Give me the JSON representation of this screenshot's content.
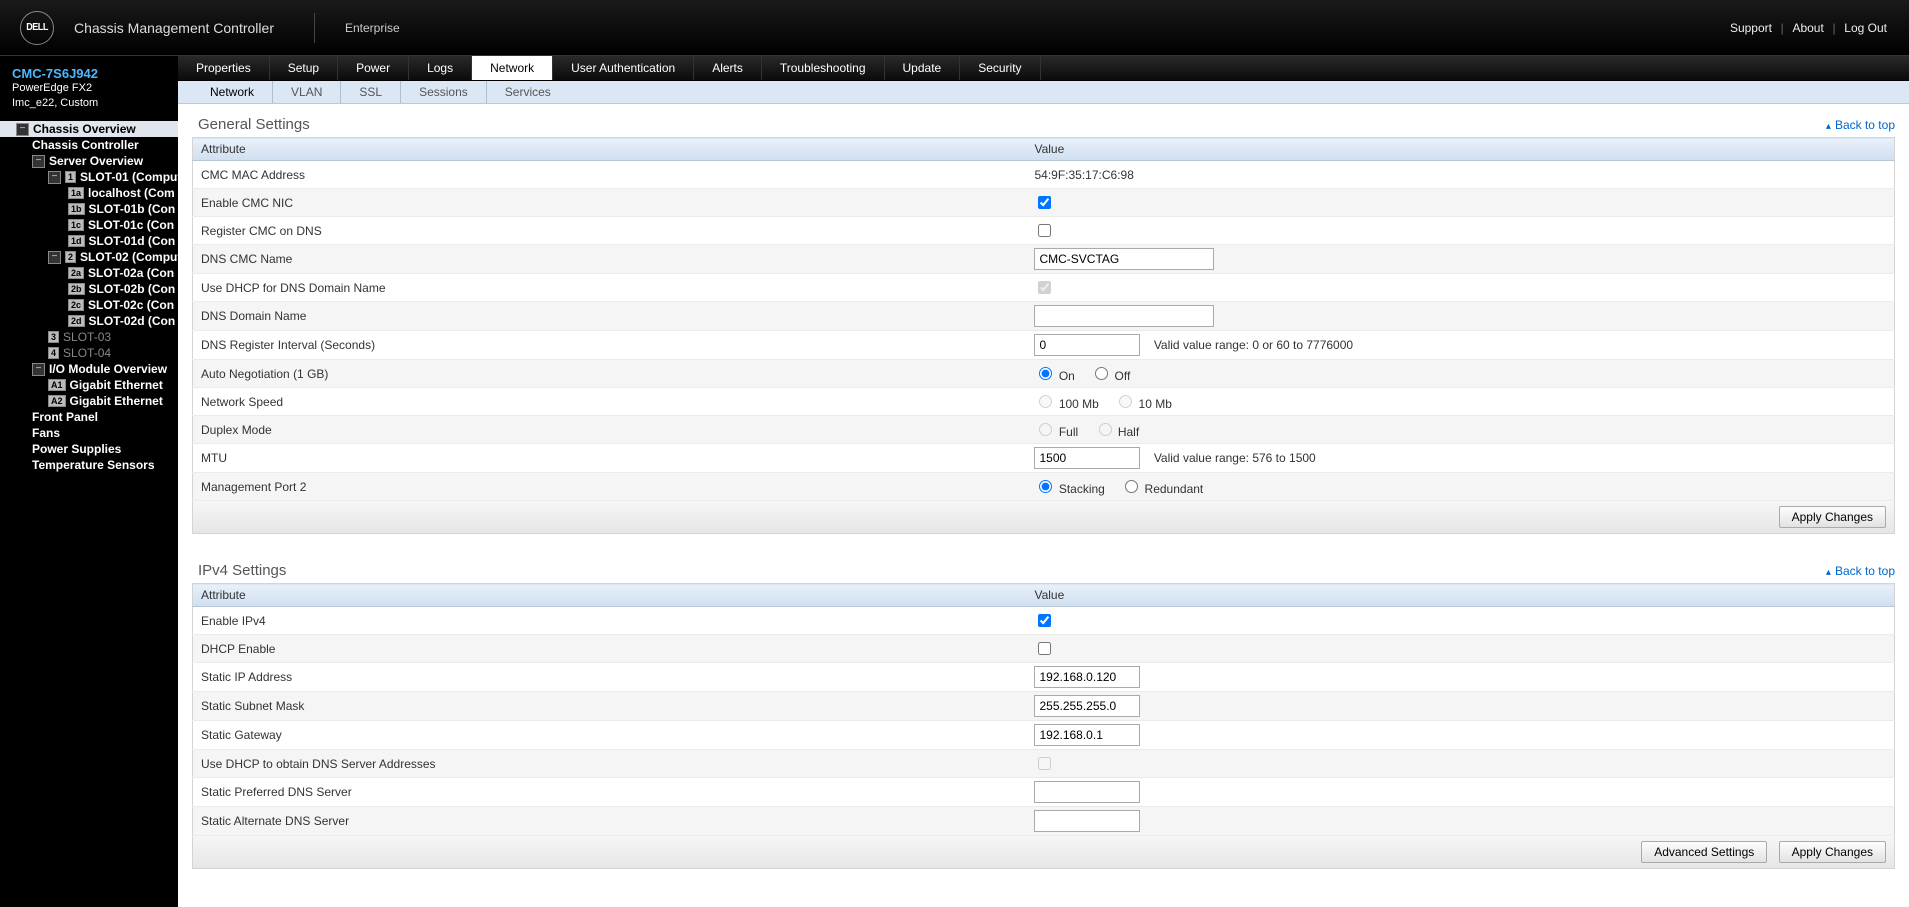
{
  "header": {
    "brand": "DELL",
    "product": "Chassis Management Controller",
    "enterprise": "Enterprise",
    "links": {
      "support": "Support",
      "about": "About",
      "logout": "Log Out"
    }
  },
  "context": {
    "svctag": "CMC-7S6J942",
    "model": "PowerEdge FX2",
    "location": "Imc_e22, Custom"
  },
  "tree": {
    "items": [
      {
        "lvl": 0,
        "tog": "-",
        "label": "Chassis Overview",
        "sel": true
      },
      {
        "lvl": 1,
        "label": "Chassis Controller"
      },
      {
        "lvl": 1,
        "tog": "-",
        "label": "Server Overview"
      },
      {
        "lvl": 2,
        "tog": "-",
        "badge": "1",
        "label": "SLOT-01 (Compute"
      },
      {
        "lvl": 3,
        "badge": "1a",
        "label": "localhost (Com"
      },
      {
        "lvl": 3,
        "badge": "1b",
        "label": "SLOT-01b (Con"
      },
      {
        "lvl": 3,
        "badge": "1c",
        "label": "SLOT-01c (Con"
      },
      {
        "lvl": 3,
        "badge": "1d",
        "label": "SLOT-01d (Con"
      },
      {
        "lvl": 2,
        "tog": "-",
        "badge": "2",
        "label": "SLOT-02 (Compute"
      },
      {
        "lvl": 3,
        "badge": "2a",
        "label": "SLOT-02a (Con"
      },
      {
        "lvl": 3,
        "badge": "2b",
        "label": "SLOT-02b (Con"
      },
      {
        "lvl": 3,
        "badge": "2c",
        "label": "SLOT-02c (Con"
      },
      {
        "lvl": 3,
        "badge": "2d",
        "label": "SLOT-02d (Con"
      },
      {
        "lvl": 2,
        "badge": "3",
        "label": "SLOT-03",
        "dim": true
      },
      {
        "lvl": 2,
        "badge": "4",
        "label": "SLOT-04",
        "dim": true
      },
      {
        "lvl": 1,
        "tog": "-",
        "label": "I/O Module Overview"
      },
      {
        "lvl": 2,
        "badge": "A1",
        "label": "Gigabit Ethernet"
      },
      {
        "lvl": 2,
        "badge": "A2",
        "label": "Gigabit Ethernet"
      },
      {
        "lvl": 1,
        "label": "Front Panel"
      },
      {
        "lvl": 1,
        "label": "Fans"
      },
      {
        "lvl": 1,
        "label": "Power Supplies"
      },
      {
        "lvl": 1,
        "label": "Temperature Sensors"
      }
    ]
  },
  "tabs1": [
    "Properties",
    "Setup",
    "Power",
    "Logs",
    "Network",
    "User Authentication",
    "Alerts",
    "Troubleshooting",
    "Update",
    "Security"
  ],
  "tabs1_active": 4,
  "tabs2": [
    "Network",
    "VLAN",
    "SSL",
    "Sessions",
    "Services"
  ],
  "tabs2_active": 0,
  "general": {
    "title": "General Settings",
    "back": "Back to top",
    "head": {
      "attr": "Attribute",
      "val": "Value"
    },
    "mac": {
      "label": "CMC MAC Address",
      "value": "54:9F:35:17:C6:98"
    },
    "enableNic": {
      "label": "Enable CMC NIC",
      "checked": true
    },
    "registerDns": {
      "label": "Register CMC on DNS",
      "checked": false
    },
    "dnsName": {
      "label": "DNS CMC Name",
      "value": "CMC-SVCTAG"
    },
    "useDhcpDomain": {
      "label": "Use DHCP for DNS Domain Name",
      "checked": true,
      "disabled": true
    },
    "dnsDomain": {
      "label": "DNS Domain Name",
      "value": ""
    },
    "dnsInterval": {
      "label": "DNS Register Interval (Seconds)",
      "value": "0",
      "hint": "Valid value range: 0 or 60 to 7776000"
    },
    "autoneg": {
      "label": "Auto Negotiation (1 GB)",
      "on": "On",
      "off": "Off",
      "value": "on"
    },
    "speed": {
      "label": "Network Speed",
      "opt1": "100 Mb",
      "opt2": "10 Mb",
      "disabled": true
    },
    "duplex": {
      "label": "Duplex Mode",
      "opt1": "Full",
      "opt2": "Half",
      "disabled": true
    },
    "mtu": {
      "label": "MTU",
      "value": "1500",
      "hint": "Valid value range: 576 to 1500"
    },
    "mgmt2": {
      "label": "Management Port 2",
      "opt1": "Stacking",
      "opt2": "Redundant",
      "value": "stacking"
    },
    "apply": "Apply Changes"
  },
  "ipv4": {
    "title": "IPv4 Settings",
    "back": "Back to top",
    "head": {
      "attr": "Attribute",
      "val": "Value"
    },
    "enable": {
      "label": "Enable IPv4",
      "checked": true
    },
    "dhcp": {
      "label": "DHCP Enable",
      "checked": false
    },
    "ip": {
      "label": "Static IP Address",
      "value": "192.168.0.120"
    },
    "mask": {
      "label": "Static Subnet Mask",
      "value": "255.255.255.0"
    },
    "gw": {
      "label": "Static Gateway",
      "value": "192.168.0.1"
    },
    "useDhcpDns": {
      "label": "Use DHCP to obtain DNS Server Addresses",
      "checked": false,
      "disabled": true
    },
    "dns1": {
      "label": "Static Preferred DNS Server",
      "value": ""
    },
    "dns2": {
      "label": "Static Alternate DNS Server",
      "value": ""
    },
    "adv": "Advanced Settings",
    "apply": "Apply Changes"
  }
}
